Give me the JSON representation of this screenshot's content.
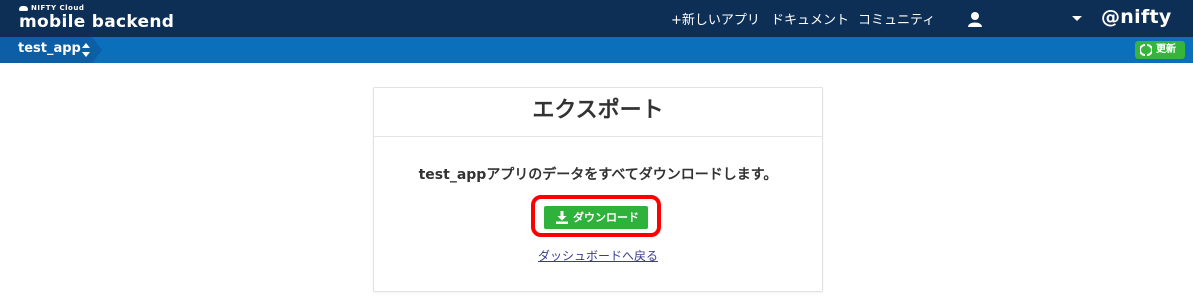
{
  "header": {
    "brand_small": "NIFTY Cloud",
    "brand_main": "mobile backend",
    "nav": [
      "+新しいアプリ",
      "ドキュメント",
      "コミュニティ"
    ],
    "user_icon": "user-icon",
    "logo_text": "@nifty"
  },
  "subbar": {
    "app_name": "test_app",
    "refresh_label": "更新"
  },
  "panel": {
    "title": "エクスポート",
    "description": "test_appアプリのデータをすべてダウンロードします。",
    "download_label": "ダウンロード",
    "back_link": "ダッシュボードへ戻る"
  },
  "colors": {
    "header_bg": "#0d2f56",
    "subbar_bg": "#0a70bb",
    "button_green": "#2fb23b",
    "highlight": "#ff0000"
  }
}
